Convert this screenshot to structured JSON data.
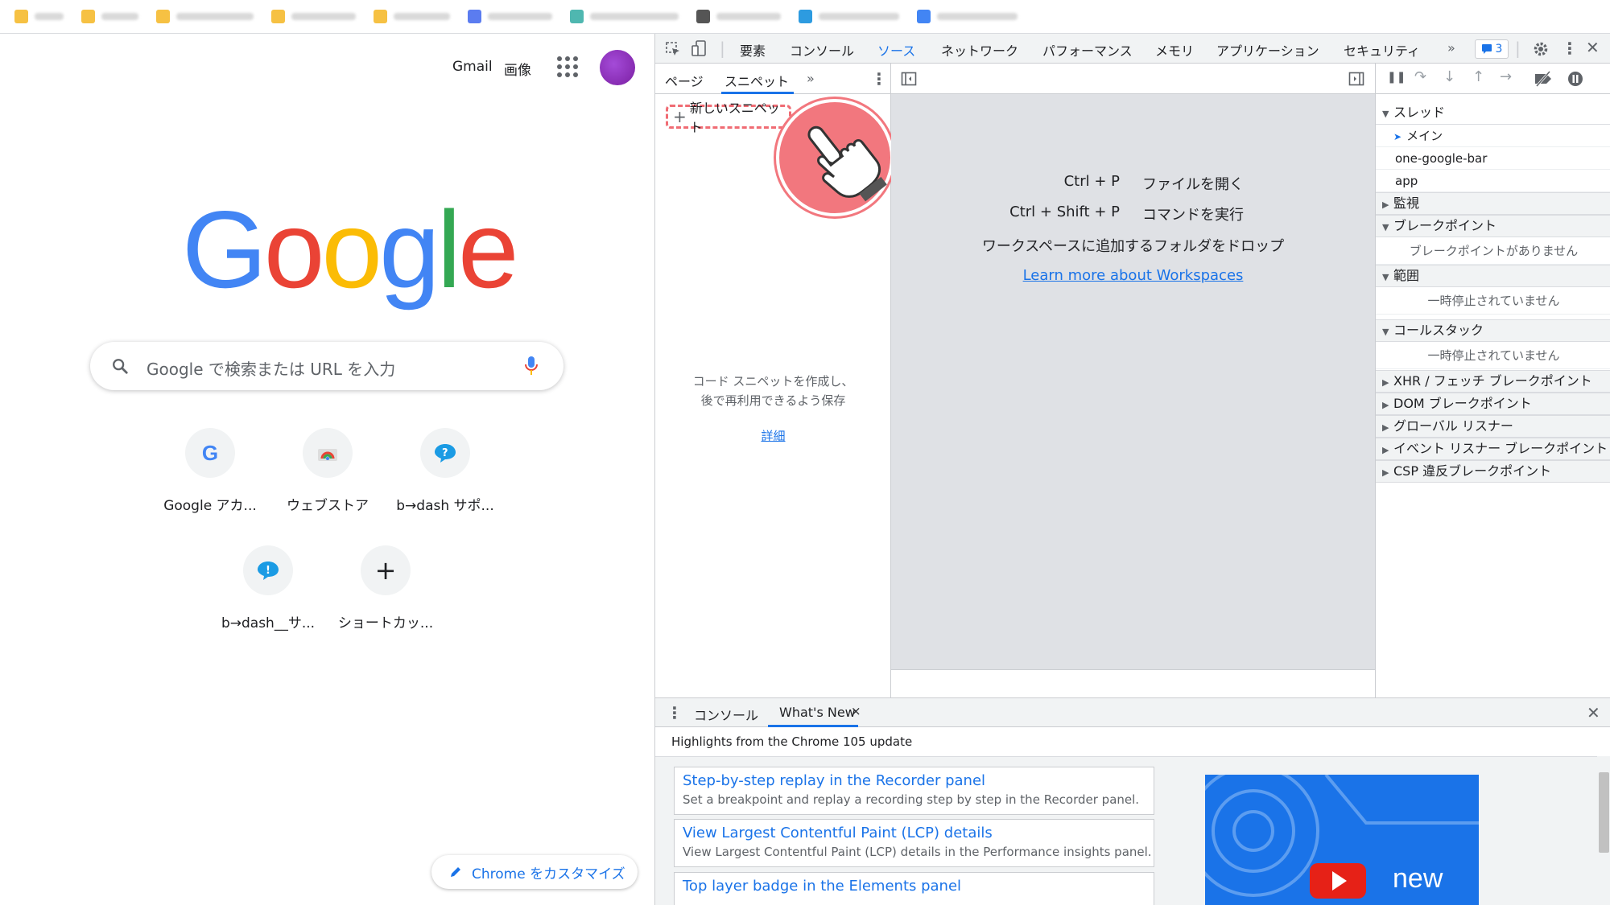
{
  "ntp": {
    "gmail": "Gmail",
    "images": "画像",
    "logo": [
      "G",
      "o",
      "o",
      "g",
      "l",
      "e"
    ],
    "search_placeholder": "Google で検索または URL を入力",
    "tiles": [
      {
        "label": "Google アカ...",
        "icon": "G"
      },
      {
        "label": "ウェブストア",
        "icon": "webstore"
      },
      {
        "label": "b→dash サポ...",
        "icon": "b-dash"
      },
      {
        "label": "b→dash__サ...",
        "icon": "b-dash"
      },
      {
        "label": "ショートカッ...",
        "icon": "+"
      }
    ],
    "customize": "Chrome をカスタマイズ"
  },
  "devtools": {
    "tabs": [
      "要素",
      "コンソール",
      "ソース",
      "ネットワーク",
      "パフォーマンス",
      "メモリ",
      "アプリケーション",
      "セキュリティ"
    ],
    "active_tab": "ソース",
    "more": "»",
    "issues_count": "3",
    "navigator": {
      "tabs": [
        "ページ",
        "スニペット"
      ],
      "active_tab": "スニペット",
      "more": "»",
      "new_snippet": "新しいスニペット",
      "empty_line1": "コード スニペットを作成し、",
      "empty_line2": "後で再利用できるよう保存",
      "details_link": "詳細"
    },
    "editor": {
      "shortcuts": [
        {
          "keys": "Ctrl + P",
          "action": "ファイルを開く"
        },
        {
          "keys": "Ctrl + Shift + P",
          "action": "コマンドを実行"
        }
      ],
      "drop_text": "ワークスペースに追加するフォルダをドロップ",
      "workspace_link": "Learn more about Workspaces"
    },
    "debugger": {
      "threads_header": "スレッド",
      "threads": [
        "メイン",
        "one-google-bar",
        "app"
      ],
      "watch": "監視",
      "breakpoints": "ブレークポイント",
      "no_breakpoints": "ブレークポイントがありません",
      "scope": "範囲",
      "not_paused_1": "一時停止されていません",
      "call_stack": "コールスタック",
      "not_paused_2": "一時停止されていません",
      "xhr": "XHR / フェッチ ブレークポイント",
      "dom": "DOM ブレークポイント",
      "global": "グローバル リスナー",
      "event": "イベント リスナー ブレークポイント",
      "csp": "CSP 違反ブレークポイント"
    },
    "drawer": {
      "tabs": [
        "コンソール",
        "What's New"
      ],
      "close_tab": "×",
      "highlights": "Highlights from the Chrome 105 update",
      "cards": [
        {
          "title": "Step-by-step replay in the Recorder panel",
          "desc": "Set a breakpoint and replay a recording step by step in the Recorder panel."
        },
        {
          "title": "View Largest Contentful Paint (LCP) details",
          "desc": "View Largest Contentful Paint (LCP) details in the Performance insights panel."
        },
        {
          "title": "Top layer badge in the Elements panel",
          "desc": ""
        }
      ],
      "video_text": "new"
    }
  },
  "colors": {
    "accent": "#1a73e8",
    "highlight": "#f06c74"
  }
}
